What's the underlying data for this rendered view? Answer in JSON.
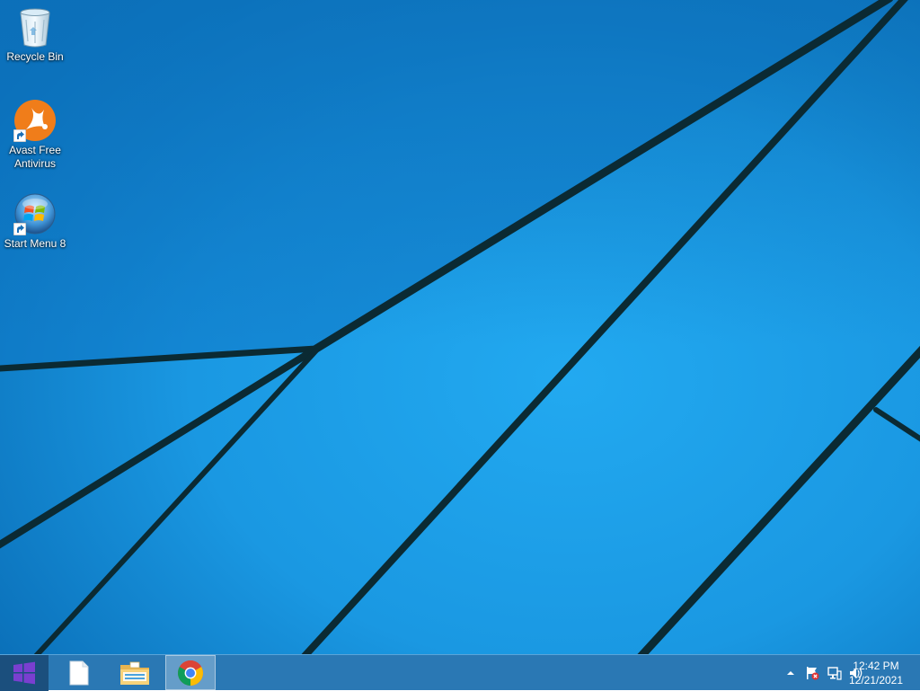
{
  "desktop": {
    "icons": [
      {
        "label": "Recycle Bin",
        "icon": "recycle-bin-icon"
      },
      {
        "label": "Avast Free\nAntivirus",
        "line1": "Avast Free",
        "line2": "Antivirus",
        "icon": "avast-icon",
        "shortcut": true
      },
      {
        "label": "Start Menu 8",
        "icon": "start-menu-8-icon",
        "shortcut": true
      }
    ],
    "wallpaper_colors": {
      "base": "#1e9fe8",
      "dark": "#0a6fb8",
      "lines": "#0b2a33"
    }
  },
  "taskbar": {
    "start_icon": "windows-logo-icon",
    "start_color": "#7a3fd0",
    "pinned": [
      {
        "name": "blank-document",
        "icon": "document-icon"
      },
      {
        "name": "file-explorer",
        "icon": "file-explorer-icon"
      },
      {
        "name": "google-chrome",
        "icon": "chrome-icon",
        "active": true
      }
    ],
    "tray": {
      "icons": [
        "show-hidden-icons-icon",
        "action-center-flag-icon",
        "network-icon",
        "volume-icon"
      ],
      "time": "12:42 PM",
      "date": "12/21/2021"
    }
  }
}
